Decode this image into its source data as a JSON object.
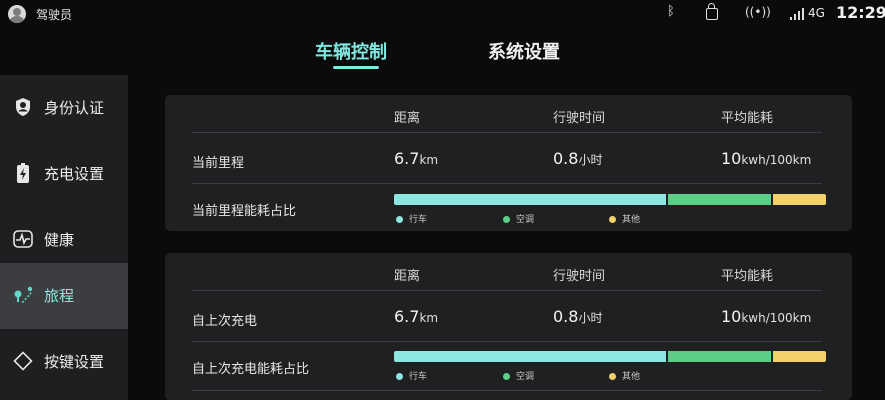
{
  "status_bar": {
    "user_name": "驾驶员",
    "network": "4G",
    "time": "12:29",
    "icons": [
      "avatar-icon",
      "bluetooth-icon",
      "lock-icon",
      "hotspot-icon",
      "signal-icon"
    ]
  },
  "tabs": [
    {
      "label": "车辆控制",
      "active": true
    },
    {
      "label": "系统设置",
      "active": false
    }
  ],
  "sidebar": {
    "items": [
      {
        "label": "身份认证",
        "icon": "shield-user-icon",
        "active": false
      },
      {
        "label": "充电设置",
        "icon": "battery-charge-icon",
        "active": false
      },
      {
        "label": "健康",
        "icon": "heartbeat-icon",
        "active": false
      },
      {
        "label": "旅程",
        "icon": "route-icon",
        "active": true
      },
      {
        "label": "按键设置",
        "icon": "diamond-key-icon",
        "active": false
      }
    ]
  },
  "panels": [
    {
      "headers": [
        "距离",
        "行驶时间",
        "平均能耗"
      ],
      "row_label": "当前里程",
      "distance_value": "6.7",
      "distance_unit": "km",
      "time_value": "0.8",
      "time_unit": "小时",
      "energy_value": "10",
      "energy_unit": "kwh/100km",
      "ratio_label": "当前里程能耗占比",
      "ratio": {
        "driving": 0.635,
        "ac": 0.24,
        "other": 0.125
      },
      "legend": [
        "行车",
        "空调",
        "其他"
      ]
    },
    {
      "headers": [
        "距离",
        "行驶时间",
        "平均能耗"
      ],
      "row_label": "自上次充电",
      "distance_value": "6.7",
      "distance_unit": "km",
      "time_value": "0.8",
      "time_unit": "小时",
      "energy_value": "10",
      "energy_unit": "kwh/100km",
      "ratio_label": "自上次充电能耗占比",
      "ratio": {
        "driving": 0.635,
        "ac": 0.24,
        "other": 0.125
      },
      "legend": [
        "行车",
        "空调",
        "其他"
      ]
    }
  ],
  "colors": {
    "accent": "#7fe8e0",
    "driving": "#8ee6e0",
    "ac": "#5ccf87",
    "other": "#f3d16a"
  }
}
